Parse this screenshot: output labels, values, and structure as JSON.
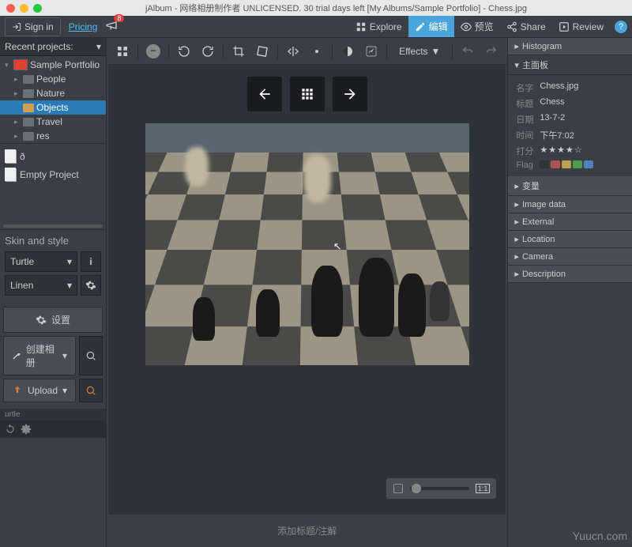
{
  "window": {
    "title": "jAlbum - 网络相册制作者 UNLICENSED. 30 trial days left [My Albums/Sample Portfolio] - Chess.jpg"
  },
  "topbar": {
    "sign_in": "Sign in",
    "pricing": "Pricing",
    "notif_count": "8",
    "explore": "Explore",
    "edit": "编辑",
    "preview": "预览",
    "share": "Share",
    "review": "Review"
  },
  "sidebar": {
    "recent_header": "Recent projects:",
    "root": "Sample Portfolio",
    "folders": [
      "People",
      "Nature",
      "Objects",
      "Travel",
      "res"
    ],
    "projects": [
      "ð",
      "Empty Project"
    ],
    "skin_title": "Skin and style",
    "skin": "Turtle",
    "style": "Linen",
    "settings": "设置",
    "create": "创建相册",
    "upload": "Upload",
    "status": "urtle"
  },
  "toolbar": {
    "effects": "Effects"
  },
  "viewer": {
    "caption_placeholder": "添加标题/注解"
  },
  "panels": {
    "histogram": "Histogram",
    "main_panel": "主面板",
    "variables": "变量",
    "image_data": "Image data",
    "external": "External",
    "location": "Location",
    "camera": "Camera",
    "description": "Description"
  },
  "meta": {
    "labels": {
      "name": "名字",
      "title": "标题",
      "date": "日期",
      "time": "时间",
      "rating": "打分",
      "flag": "Flag"
    },
    "name": "Chess.jpg",
    "title": "Chess",
    "date": "13-7-2",
    "time": "下午7:02",
    "rating": "★★★★☆",
    "flag_colors": [
      "#333",
      "#b05050",
      "#c0a050",
      "#50a050",
      "#5080c0"
    ]
  },
  "tl_colors": {
    "close": "#ff5f57",
    "min": "#febc2e",
    "max": "#28c840"
  },
  "watermark": "Yuucn.com"
}
